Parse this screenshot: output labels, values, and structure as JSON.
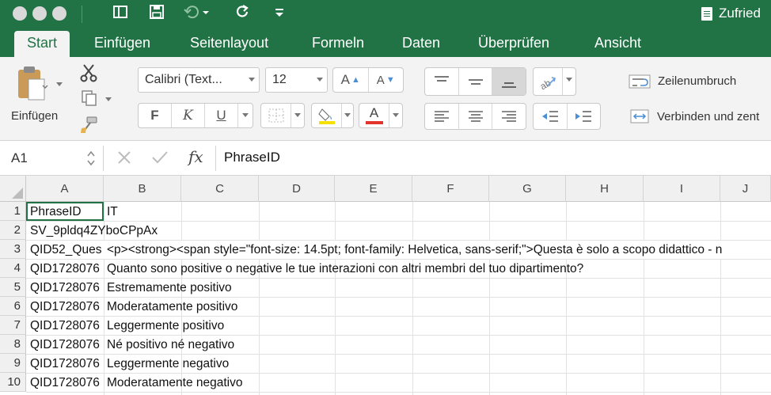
{
  "window": {
    "title": "Zufried"
  },
  "quick_access": {
    "icons": [
      "sidebar-icon",
      "save-icon",
      "undo-icon",
      "redo-icon",
      "customize-icon"
    ]
  },
  "tabs": [
    {
      "label": "Start",
      "active": true
    },
    {
      "label": "Einfügen"
    },
    {
      "label": "Seitenlayout"
    },
    {
      "label": "Formeln"
    },
    {
      "label": "Daten"
    },
    {
      "label": "Überprüfen"
    },
    {
      "label": "Ansicht"
    }
  ],
  "ribbon": {
    "paste_label": "Einfügen",
    "font_name": "Calibri (Text...",
    "font_size": "12",
    "grow_font_label": "A",
    "shrink_font_label": "A",
    "bold_label": "F",
    "italic_label": "K",
    "underline_label": "U",
    "font_color_label": "A",
    "wrap_text_label": "Zeilenumbruch",
    "merge_label": "Verbinden und zent"
  },
  "formula_bar": {
    "name_box": "A1",
    "fx_label": "fx",
    "content": "PhraseID"
  },
  "sheet": {
    "columns": [
      "A",
      "B",
      "C",
      "D",
      "E",
      "F",
      "G",
      "H",
      "I",
      "J"
    ],
    "rows": [
      {
        "num": "1",
        "a": "PhraseID",
        "b": "IT"
      },
      {
        "num": "2",
        "a": "SV_9pldq4ZYboCPpAx",
        "b": ""
      },
      {
        "num": "3",
        "a": "QID52_Ques",
        "b": "<p><strong><span style=\"font-size: 14.5pt; font-family: Helvetica, sans-serif;\">Questa è solo a scopo didattico - n"
      },
      {
        "num": "4",
        "a": "QID1728076",
        "b": "Quanto sono positive o negative le tue interazioni con altri membri del tuo dipartimento?"
      },
      {
        "num": "5",
        "a": "QID1728076",
        "b": "Estremamente positivo"
      },
      {
        "num": "6",
        "a": "QID1728076",
        "b": "Moderatamente positivo"
      },
      {
        "num": "7",
        "a": "QID1728076",
        "b": "Leggermente positivo"
      },
      {
        "num": "8",
        "a": "QID1728076",
        "b": "Né positivo né negativo"
      },
      {
        "num": "9",
        "a": "QID1728076",
        "b": "Leggermente negativo"
      },
      {
        "num": "10",
        "a": "QID1728076",
        "b": "Moderatamente negativo"
      }
    ]
  },
  "colors": {
    "accent": "#217346",
    "font_color_swatch": "#e2342a",
    "fill_color_swatch": "#f5e000"
  }
}
